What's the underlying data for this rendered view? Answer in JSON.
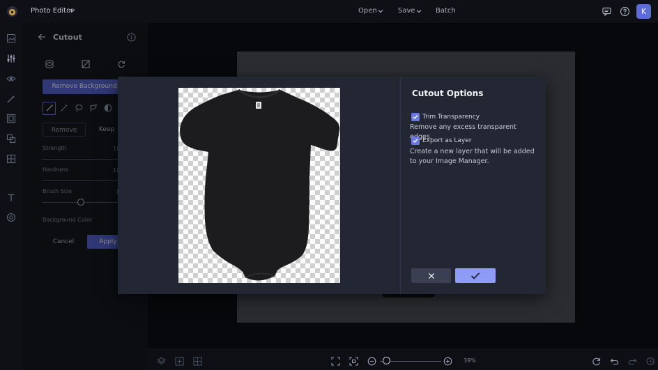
{
  "header": {
    "app_name": "Photo Editor",
    "menu": [
      {
        "label": "Open",
        "has_dropdown": true
      },
      {
        "label": "Save",
        "has_dropdown": true
      },
      {
        "label": "Batch",
        "has_dropdown": false
      }
    ],
    "icons": [
      "chat-icon",
      "help-icon"
    ],
    "avatar_initial": "K"
  },
  "rail": {
    "icons": [
      "image-icon",
      "sliders-icon",
      "eye-icon",
      "magic-icon",
      "frame-icon",
      "overlay-icon",
      "texture-icon",
      "text-icon",
      "graphics-icon"
    ]
  },
  "panel": {
    "title": "Cutout",
    "remove_background_label": "Remove Background",
    "mode_remove": "Remove",
    "mode_keep": "Keep",
    "strength_label": "Strength",
    "strength_value": "10",
    "hardness_label": "Hardness",
    "hardness_value": "10",
    "brush_size_label": "Brush Size",
    "brush_size_value": "1",
    "background_color_label": "Background Color",
    "cancel_label": "Cancel",
    "apply_label": "Apply"
  },
  "modal": {
    "title": "Cutout Options",
    "options": [
      {
        "label": "Trim Transparency",
        "checked": true,
        "description": "Remove any excess transparent edges."
      },
      {
        "label": "Export as Layer",
        "checked": true,
        "description": "Create a new layer that will be added to your Image Manager."
      }
    ]
  },
  "bottom": {
    "zoom": "39%"
  },
  "colors": {
    "accent": "#5867d8",
    "confirm": "#8e9cf5",
    "modal_bg": "#232734",
    "canvas_bg": "#07080b"
  }
}
